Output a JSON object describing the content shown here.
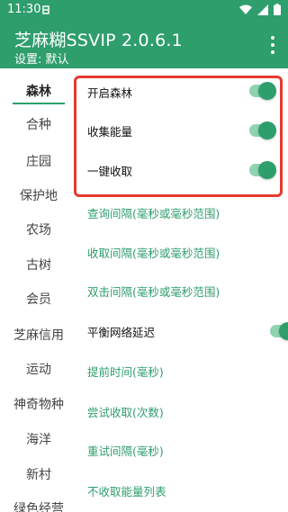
{
  "status_bar": {
    "time": "11:30",
    "icons": [
      "notification-icon",
      "wifi-icon",
      "signal-icon",
      "battery-icon"
    ]
  },
  "app_bar": {
    "title": "芝麻糊SSVIP 2.0.6.1",
    "subtitle": "设置: 默认",
    "overflow_icon": "more-vert-icon"
  },
  "colors": {
    "primary": "#2e9e6c",
    "toggle_track": "#8fd3b1",
    "highlight_border": "#e53a2f"
  },
  "sidebar": {
    "active_index": 0,
    "items": [
      {
        "label": "森林"
      },
      {
        "label": "合种"
      },
      {
        "label": "庄园"
      },
      {
        "label": "保护地"
      },
      {
        "label": "农场"
      },
      {
        "label": "古树"
      },
      {
        "label": "会员"
      },
      {
        "label": "芝麻信用"
      },
      {
        "label": "运动"
      },
      {
        "label": "神奇物种"
      },
      {
        "label": "海洋"
      },
      {
        "label": "新村"
      },
      {
        "label": "绿色经营"
      }
    ]
  },
  "settings": {
    "open_forest": {
      "label": "开启森林",
      "enabled": true
    },
    "collect_energy": {
      "label": "收集能量",
      "enabled": true
    },
    "one_key_collect": {
      "label": "一键收取",
      "enabled": true
    },
    "query_interval": {
      "label": "查询间隔(毫秒或毫秒范围)"
    },
    "collect_interval": {
      "label": "收取间隔(毫秒或毫秒范围)"
    },
    "double_click_interval": {
      "label": "双击间隔(毫秒或毫秒范围)"
    },
    "balance_network_delay": {
      "label": "平衡网络延迟",
      "enabled": true
    },
    "advance_time": {
      "label": "提前时间(毫秒)"
    },
    "try_collect": {
      "label": "尝试收取(次数)"
    },
    "retry_interval": {
      "label": "重试间隔(毫秒)"
    },
    "no_collect_list": {
      "label": "不收取能量列表"
    }
  }
}
